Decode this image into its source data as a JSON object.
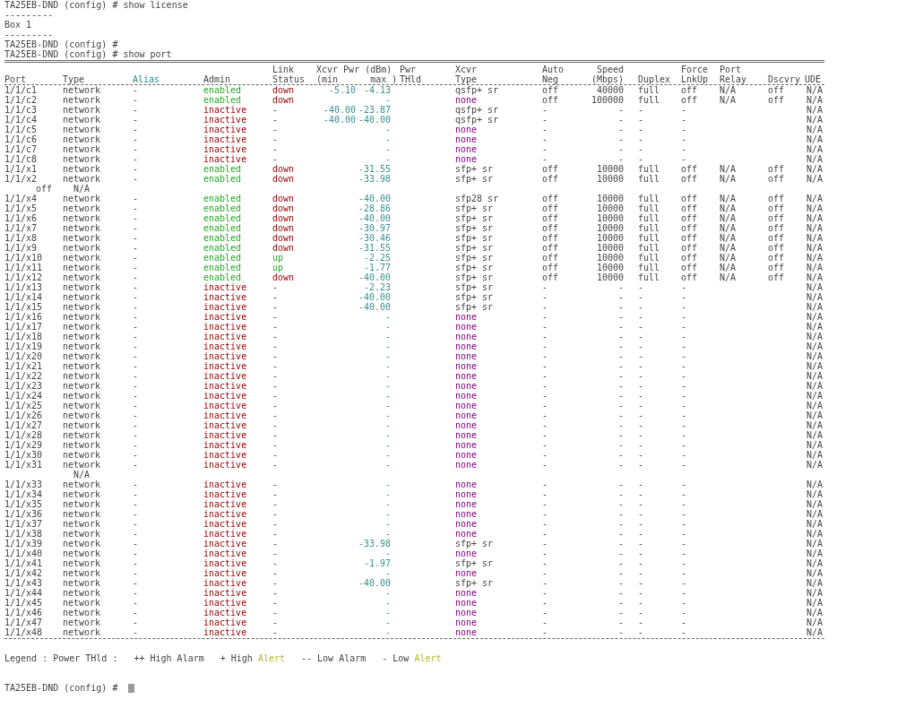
{
  "lines_before": [
    "TA25EB-DND (config) # show license",
    "---------",
    "Box 1",
    "---------",
    "TA25EB-DND (config) #",
    "TA25EB-DND (config) # show port"
  ],
  "table": {
    "columns": [
      {
        "kind": "port",
        "label": "Port"
      },
      {
        "kind": "type",
        "label": "Type"
      },
      {
        "kind": "alias",
        "label": "Alias"
      },
      {
        "kind": "admin",
        "label": "Admin"
      },
      {
        "kind": "link",
        "label": "Link\nStatus"
      },
      {
        "kind": "pwr",
        "label": "Xcvr Pwr (dBm)\n(min      max )"
      },
      {
        "kind": "thld",
        "label": "Pwr\nTHld"
      },
      {
        "kind": "xcvr",
        "label": "Xcvr\nType"
      },
      {
        "kind": "auto",
        "label": "Auto\nNeg"
      },
      {
        "kind": "speed",
        "label": "Speed\n(Mbps)"
      },
      {
        "kind": "duplex",
        "label": "Duplex"
      },
      {
        "kind": "force",
        "label": "Force\nLnkUp"
      },
      {
        "kind": "relay",
        "label": "Port\nRelay"
      },
      {
        "kind": "dscvry",
        "label": "Dscvry"
      },
      {
        "kind": "ude",
        "label": "UDE"
      }
    ],
    "rows": [
      {
        "kind": "port",
        "port": "1/1/c1",
        "type": "network",
        "alias": "-",
        "admin": "enabled",
        "enabled": true,
        "link": "down",
        "link_up": false,
        "pwr_min": "-5.10",
        "pwr_max": "-4.13",
        "xcvr": "qsfp+ sr",
        "xcvr_present": true,
        "auto_neg": "off",
        "speed": "40000",
        "duplex": "full",
        "force_lnkup": "off",
        "port_relay": "N/A",
        "dscvry": "off",
        "ude": "N/A"
      },
      {
        "kind": "port",
        "port": "1/1/c2",
        "type": "network",
        "alias": "-",
        "admin": "enabled",
        "enabled": true,
        "link": "down",
        "link_up": false,
        "pwr_max": "-",
        "xcvr": "none",
        "xcvr_present": false,
        "auto_neg": "off",
        "speed": "100000",
        "duplex": "full",
        "force_lnkup": "off",
        "port_relay": "N/A",
        "dscvry": "off",
        "ude": "N/A"
      },
      {
        "kind": "port",
        "port": "1/1/c3",
        "type": "network",
        "alias": "-",
        "admin": "inactive",
        "enabled": false,
        "link": "-",
        "pwr_min": "-40.00",
        "pwr_max": "-23.87",
        "xcvr": "qsfp+ sr",
        "xcvr_present": true,
        "auto_neg": "-",
        "speed": "-",
        "duplex": "-",
        "force_lnkup": "-",
        "ude": "N/A"
      },
      {
        "kind": "port",
        "port": "1/1/c4",
        "type": "network",
        "alias": "-",
        "admin": "inactive",
        "enabled": false,
        "link": "-",
        "pwr_min": "-40.00",
        "pwr_max": "-40.00",
        "xcvr": "qsfp+ sr",
        "xcvr_present": true,
        "auto_neg": "-",
        "speed": "-",
        "duplex": "-",
        "force_lnkup": "-",
        "ude": "N/A"
      },
      {
        "kind": "port",
        "port": "1/1/c5",
        "type": "network",
        "alias": "-",
        "admin": "inactive",
        "enabled": false,
        "link": "-",
        "pwr_max": "-",
        "xcvr": "none",
        "xcvr_present": false,
        "auto_neg": "-",
        "speed": "-",
        "duplex": "-",
        "force_lnkup": "-",
        "ude": "N/A"
      },
      {
        "kind": "port",
        "port": "1/1/c6",
        "type": "network",
        "alias": "-",
        "admin": "inactive",
        "enabled": false,
        "link": "-",
        "pwr_max": "-",
        "xcvr": "none",
        "xcvr_present": false,
        "auto_neg": "-",
        "speed": "-",
        "duplex": "-",
        "force_lnkup": "-",
        "ude": "N/A"
      },
      {
        "kind": "port",
        "port": "1/1/c7",
        "type": "network",
        "alias": "-",
        "admin": "inactive",
        "enabled": false,
        "link": "-",
        "pwr_max": "-",
        "xcvr": "none",
        "xcvr_present": false,
        "auto_neg": "-",
        "speed": "-",
        "duplex": "-",
        "force_lnkup": "-",
        "ude": "N/A"
      },
      {
        "kind": "port",
        "port": "1/1/c8",
        "type": "network",
        "alias": "-",
        "admin": "inactive",
        "enabled": false,
        "link": "-",
        "pwr_max": "-",
        "xcvr": "none",
        "xcvr_present": false,
        "auto_neg": "-",
        "speed": "-",
        "duplex": "-",
        "force_lnkup": "-",
        "ude": "N/A"
      },
      {
        "kind": "port",
        "port": "1/1/x1",
        "type": "network",
        "alias": "-",
        "admin": "enabled",
        "enabled": true,
        "link": "down",
        "link_up": false,
        "pwr_max": "-31.55",
        "xcvr": "sfp+ sr",
        "xcvr_present": true,
        "auto_neg": "off",
        "speed": "10000",
        "duplex": "full",
        "force_lnkup": "off",
        "port_relay": "N/A",
        "dscvry": "off",
        "ude": "N/A"
      },
      {
        "kind": "port",
        "port": "1/1/x2",
        "type": "network",
        "alias": "-",
        "admin": "enabled",
        "enabled": true,
        "link": "down",
        "link_up": false,
        "pwr_max": "-33.98",
        "xcvr": "sfp+ sr",
        "xcvr_present": true,
        "auto_neg": "off",
        "speed": "10000",
        "duplex": "full",
        "force_lnkup": "off",
        "port_relay": "N/A",
        "dscvry": "off",
        "ude": "N/A"
      },
      {
        "kind": "wrap",
        "parts": [
          "off",
          "N/A"
        ]
      },
      {
        "kind": "port",
        "port": "1/1/x4",
        "type": "network",
        "alias": "-",
        "admin": "enabled",
        "enabled": true,
        "link": "down",
        "link_up": false,
        "pwr_max": "-40.00",
        "xcvr": "sfp28 sr",
        "xcvr_present": true,
        "auto_neg": "off",
        "speed": "10000",
        "duplex": "full",
        "force_lnkup": "off",
        "port_relay": "N/A",
        "dscvry": "off",
        "ude": "N/A"
      },
      {
        "kind": "port",
        "port": "1/1/x5",
        "type": "network",
        "alias": "-",
        "admin": "enabled",
        "enabled": true,
        "link": "down",
        "link_up": false,
        "pwr_max": "-28.86",
        "xcvr": "sfp+ sr",
        "xcvr_present": true,
        "auto_neg": "off",
        "speed": "10000",
        "duplex": "full",
        "force_lnkup": "off",
        "port_relay": "N/A",
        "dscvry": "off",
        "ude": "N/A"
      },
      {
        "kind": "port",
        "port": "1/1/x6",
        "type": "network",
        "alias": "-",
        "admin": "enabled",
        "enabled": true,
        "link": "down",
        "link_up": false,
        "pwr_max": "-40.00",
        "xcvr": "sfp+ sr",
        "xcvr_present": true,
        "auto_neg": "off",
        "speed": "10000",
        "duplex": "full",
        "force_lnkup": "off",
        "port_relay": "N/A",
        "dscvry": "off",
        "ude": "N/A"
      },
      {
        "kind": "port",
        "port": "1/1/x7",
        "type": "network",
        "alias": "-",
        "admin": "enabled",
        "enabled": true,
        "link": "down",
        "link_up": false,
        "pwr_max": "-30.97",
        "xcvr": "sfp+ sr",
        "xcvr_present": true,
        "auto_neg": "off",
        "speed": "10000",
        "duplex": "full",
        "force_lnkup": "off",
        "port_relay": "N/A",
        "dscvry": "off",
        "ude": "N/A"
      },
      {
        "kind": "port",
        "port": "1/1/x8",
        "type": "network",
        "alias": "-",
        "admin": "enabled",
        "enabled": true,
        "link": "down",
        "link_up": false,
        "pwr_max": "-30.46",
        "xcvr": "sfp+ sr",
        "xcvr_present": true,
        "auto_neg": "off",
        "speed": "10000",
        "duplex": "full",
        "force_lnkup": "off",
        "port_relay": "N/A",
        "dscvry": "off",
        "ude": "N/A"
      },
      {
        "kind": "port",
        "port": "1/1/x9",
        "type": "network",
        "alias": "-",
        "admin": "enabled",
        "enabled": true,
        "link": "down",
        "link_up": false,
        "pwr_max": "-31.55",
        "xcvr": "sfp+ sr",
        "xcvr_present": true,
        "auto_neg": "off",
        "speed": "10000",
        "duplex": "full",
        "force_lnkup": "off",
        "port_relay": "N/A",
        "dscvry": "off",
        "ude": "N/A"
      },
      {
        "kind": "port",
        "port": "1/1/x10",
        "type": "network",
        "alias": "-",
        "admin": "enabled",
        "enabled": true,
        "link": "up",
        "link_up": true,
        "pwr_max": "-2.25",
        "xcvr": "sfp+ sr",
        "xcvr_present": true,
        "auto_neg": "off",
        "speed": "10000",
        "duplex": "full",
        "force_lnkup": "off",
        "port_relay": "N/A",
        "dscvry": "off",
        "ude": "N/A"
      },
      {
        "kind": "port",
        "port": "1/1/x11",
        "type": "network",
        "alias": "-",
        "admin": "enabled",
        "enabled": true,
        "link": "up",
        "link_up": true,
        "pwr_max": "-1.77",
        "xcvr": "sfp+ sr",
        "xcvr_present": true,
        "auto_neg": "off",
        "speed": "10000",
        "duplex": "full",
        "force_lnkup": "off",
        "port_relay": "N/A",
        "dscvry": "off",
        "ude": "N/A"
      },
      {
        "kind": "port",
        "port": "1/1/x12",
        "type": "network",
        "alias": "-",
        "admin": "enabled",
        "enabled": true,
        "link": "down",
        "link_up": false,
        "pwr_max": "-40.00",
        "xcvr": "sfp+ sr",
        "xcvr_present": true,
        "auto_neg": "off",
        "speed": "10000",
        "duplex": "full",
        "force_lnkup": "off",
        "port_relay": "N/A",
        "dscvry": "off",
        "ude": "N/A"
      },
      {
        "kind": "port",
        "port": "1/1/x13",
        "type": "network",
        "alias": "-",
        "admin": "inactive",
        "enabled": false,
        "link": "-",
        "pwr_max": "-2.23",
        "xcvr": "sfp+ sr",
        "xcvr_present": true,
        "auto_neg": "-",
        "speed": "-",
        "duplex": "-",
        "force_lnkup": "-",
        "ude": "N/A"
      },
      {
        "kind": "port",
        "port": "1/1/x14",
        "type": "network",
        "alias": "-",
        "admin": "inactive",
        "enabled": false,
        "link": "-",
        "pwr_max": "-40.00",
        "xcvr": "sfp+ sr",
        "xcvr_present": true,
        "auto_neg": "-",
        "speed": "-",
        "duplex": "-",
        "force_lnkup": "-",
        "ude": "N/A"
      },
      {
        "kind": "port",
        "port": "1/1/x15",
        "type": "network",
        "alias": "-",
        "admin": "inactive",
        "enabled": false,
        "link": "-",
        "pwr_max": "-40.00",
        "xcvr": "sfp+ sr",
        "xcvr_present": true,
        "auto_neg": "-",
        "speed": "-",
        "duplex": "-",
        "force_lnkup": "-",
        "ude": "N/A"
      },
      {
        "kind": "port",
        "port": "1/1/x16",
        "type": "network",
        "alias": "-",
        "admin": "inactive",
        "enabled": false,
        "link": "-",
        "pwr_max": "-",
        "xcvr": "none",
        "xcvr_present": false,
        "auto_neg": "-",
        "speed": "-",
        "duplex": "-",
        "force_lnkup": "-",
        "ude": "N/A"
      },
      {
        "kind": "port",
        "port": "1/1/x17",
        "type": "network",
        "alias": "-",
        "admin": "inactive",
        "enabled": false,
        "link": "-",
        "pwr_max": "-",
        "xcvr": "none",
        "xcvr_present": false,
        "auto_neg": "-",
        "speed": "-",
        "duplex": "-",
        "force_lnkup": "-",
        "ude": "N/A"
      },
      {
        "kind": "port",
        "port": "1/1/x18",
        "type": "network",
        "alias": "-",
        "admin": "inactive",
        "enabled": false,
        "link": "-",
        "pwr_max": "-",
        "xcvr": "none",
        "xcvr_present": false,
        "auto_neg": "-",
        "speed": "-",
        "duplex": "-",
        "force_lnkup": "-",
        "ude": "N/A"
      },
      {
        "kind": "port",
        "port": "1/1/x19",
        "type": "network",
        "alias": "-",
        "admin": "inactive",
        "enabled": false,
        "link": "-",
        "pwr_max": "-",
        "xcvr": "none",
        "xcvr_present": false,
        "auto_neg": "-",
        "speed": "-",
        "duplex": "-",
        "force_lnkup": "-",
        "ude": "N/A"
      },
      {
        "kind": "port",
        "port": "1/1/x20",
        "type": "network",
        "alias": "-",
        "admin": "inactive",
        "enabled": false,
        "link": "-",
        "pwr_max": "-",
        "xcvr": "none",
        "xcvr_present": false,
        "auto_neg": "-",
        "speed": "-",
        "duplex": "-",
        "force_lnkup": "-",
        "ude": "N/A"
      },
      {
        "kind": "port",
        "port": "1/1/x21",
        "type": "network",
        "alias": "-",
        "admin": "inactive",
        "enabled": false,
        "link": "-",
        "pwr_max": "-",
        "xcvr": "none",
        "xcvr_present": false,
        "auto_neg": "-",
        "speed": "-",
        "duplex": "-",
        "force_lnkup": "-",
        "ude": "N/A"
      },
      {
        "kind": "port",
        "port": "1/1/x22",
        "type": "network",
        "alias": "-",
        "admin": "inactive",
        "enabled": false,
        "link": "-",
        "pwr_max": "-",
        "xcvr": "none",
        "xcvr_present": false,
        "auto_neg": "-",
        "speed": "-",
        "duplex": "-",
        "force_lnkup": "-",
        "ude": "N/A"
      },
      {
        "kind": "port",
        "port": "1/1/x23",
        "type": "network",
        "alias": "-",
        "admin": "inactive",
        "enabled": false,
        "link": "-",
        "pwr_max": "-",
        "xcvr": "none",
        "xcvr_present": false,
        "auto_neg": "-",
        "speed": "-",
        "duplex": "-",
        "force_lnkup": "-",
        "ude": "N/A"
      },
      {
        "kind": "port",
        "port": "1/1/x24",
        "type": "network",
        "alias": "-",
        "admin": "inactive",
        "enabled": false,
        "link": "-",
        "pwr_max": "-",
        "xcvr": "none",
        "xcvr_present": false,
        "auto_neg": "-",
        "speed": "-",
        "duplex": "-",
        "force_lnkup": "-",
        "ude": "N/A"
      },
      {
        "kind": "port",
        "port": "1/1/x25",
        "type": "network",
        "alias": "-",
        "admin": "inactive",
        "enabled": false,
        "link": "-",
        "pwr_max": "-",
        "xcvr": "none",
        "xcvr_present": false,
        "auto_neg": "-",
        "speed": "-",
        "duplex": "-",
        "force_lnkup": "-",
        "ude": "N/A"
      },
      {
        "kind": "port",
        "port": "1/1/x26",
        "type": "network",
        "alias": "-",
        "admin": "inactive",
        "enabled": false,
        "link": "-",
        "pwr_max": "-",
        "xcvr": "none",
        "xcvr_present": false,
        "auto_neg": "-",
        "speed": "-",
        "duplex": "-",
        "force_lnkup": "-",
        "ude": "N/A"
      },
      {
        "kind": "port",
        "port": "1/1/x27",
        "type": "network",
        "alias": "-",
        "admin": "inactive",
        "enabled": false,
        "link": "-",
        "pwr_max": "-",
        "xcvr": "none",
        "xcvr_present": false,
        "auto_neg": "-",
        "speed": "-",
        "duplex": "-",
        "force_lnkup": "-",
        "ude": "N/A"
      },
      {
        "kind": "port",
        "port": "1/1/x28",
        "type": "network",
        "alias": "-",
        "admin": "inactive",
        "enabled": false,
        "link": "-",
        "pwr_max": "-",
        "xcvr": "none",
        "xcvr_present": false,
        "auto_neg": "-",
        "speed": "-",
        "duplex": "-",
        "force_lnkup": "-",
        "ude": "N/A"
      },
      {
        "kind": "port",
        "port": "1/1/x29",
        "type": "network",
        "alias": "-",
        "admin": "inactive",
        "enabled": false,
        "link": "-",
        "pwr_max": "-",
        "xcvr": "none",
        "xcvr_present": false,
        "auto_neg": "-",
        "speed": "-",
        "duplex": "-",
        "force_lnkup": "-",
        "ude": "N/A"
      },
      {
        "kind": "port",
        "port": "1/1/x30",
        "type": "network",
        "alias": "-",
        "admin": "inactive",
        "enabled": false,
        "link": "-",
        "pwr_max": "-",
        "xcvr": "none",
        "xcvr_present": false,
        "auto_neg": "-",
        "speed": "-",
        "duplex": "-",
        "force_lnkup": "-",
        "ude": "N/A"
      },
      {
        "kind": "port",
        "port": "1/1/x31",
        "type": "network",
        "alias": "-",
        "admin": "inactive",
        "enabled": false,
        "link": "-",
        "pwr_max": "-",
        "xcvr": "none",
        "xcvr_present": false,
        "auto_neg": "-",
        "speed": "-",
        "duplex": "-",
        "force_lnkup": "-",
        "ude": "N/A"
      },
      {
        "kind": "wrap",
        "parts": [
          "N/A"
        ]
      },
      {
        "kind": "port",
        "port": "1/1/x33",
        "type": "network",
        "alias": "-",
        "admin": "inactive",
        "enabled": false,
        "link": "-",
        "pwr_max": "-",
        "xcvr": "none",
        "xcvr_present": false,
        "auto_neg": "-",
        "speed": "-",
        "duplex": "-",
        "force_lnkup": "-",
        "ude": "N/A"
      },
      {
        "kind": "port",
        "port": "1/1/x34",
        "type": "network",
        "alias": "-",
        "admin": "inactive",
        "enabled": false,
        "link": "-",
        "pwr_max": "-",
        "xcvr": "none",
        "xcvr_present": false,
        "auto_neg": "-",
        "speed": "-",
        "duplex": "-",
        "force_lnkup": "-",
        "ude": "N/A"
      },
      {
        "kind": "port",
        "port": "1/1/x35",
        "type": "network",
        "alias": "-",
        "admin": "inactive",
        "enabled": false,
        "link": "-",
        "pwr_max": "-",
        "xcvr": "none",
        "xcvr_present": false,
        "auto_neg": "-",
        "speed": "-",
        "duplex": "-",
        "force_lnkup": "-",
        "ude": "N/A"
      },
      {
        "kind": "port",
        "port": "1/1/x36",
        "type": "network",
        "alias": "-",
        "admin": "inactive",
        "enabled": false,
        "link": "-",
        "pwr_max": "-",
        "xcvr": "none",
        "xcvr_present": false,
        "auto_neg": "-",
        "speed": "-",
        "duplex": "-",
        "force_lnkup": "-",
        "ude": "N/A"
      },
      {
        "kind": "port",
        "port": "1/1/x37",
        "type": "network",
        "alias": "-",
        "admin": "inactive",
        "enabled": false,
        "link": "-",
        "pwr_max": "-",
        "xcvr": "none",
        "xcvr_present": false,
        "auto_neg": "-",
        "speed": "-",
        "duplex": "-",
        "force_lnkup": "-",
        "ude": "N/A"
      },
      {
        "kind": "port",
        "port": "1/1/x38",
        "type": "network",
        "alias": "-",
        "admin": "inactive",
        "enabled": false,
        "link": "-",
        "pwr_max": "-",
        "xcvr": "none",
        "xcvr_present": false,
        "auto_neg": "-",
        "speed": "-",
        "duplex": "-",
        "force_lnkup": "-",
        "ude": "N/A"
      },
      {
        "kind": "port",
        "port": "1/1/x39",
        "type": "network",
        "alias": "-",
        "admin": "inactive",
        "enabled": false,
        "link": "-",
        "pwr_max": "-33.98",
        "xcvr": "sfp+ sr",
        "xcvr_present": true,
        "auto_neg": "-",
        "speed": "-",
        "duplex": "-",
        "force_lnkup": "-",
        "ude": "N/A"
      },
      {
        "kind": "port",
        "port": "1/1/x40",
        "type": "network",
        "alias": "-",
        "admin": "inactive",
        "enabled": false,
        "link": "-",
        "pwr_max": "-",
        "xcvr": "none",
        "xcvr_present": false,
        "auto_neg": "-",
        "speed": "-",
        "duplex": "-",
        "force_lnkup": "-",
        "ude": "N/A"
      },
      {
        "kind": "port",
        "port": "1/1/x41",
        "type": "network",
        "alias": "-",
        "admin": "inactive",
        "enabled": false,
        "link": "-",
        "pwr_max": "-1.97",
        "xcvr": "sfp+ sr",
        "xcvr_present": true,
        "auto_neg": "-",
        "speed": "-",
        "duplex": "-",
        "force_lnkup": "-",
        "ude": "N/A"
      },
      {
        "kind": "port",
        "port": "1/1/x42",
        "type": "network",
        "alias": "-",
        "admin": "inactive",
        "enabled": false,
        "link": "-",
        "pwr_max": "-",
        "xcvr": "none",
        "xcvr_present": false,
        "auto_neg": "-",
        "speed": "-",
        "duplex": "-",
        "force_lnkup": "-",
        "ude": "N/A"
      },
      {
        "kind": "port",
        "port": "1/1/x43",
        "type": "network",
        "alias": "-",
        "admin": "inactive",
        "enabled": false,
        "link": "-",
        "pwr_max": "-40.00",
        "xcvr": "sfp+ sr",
        "xcvr_present": true,
        "auto_neg": "-",
        "speed": "-",
        "duplex": "-",
        "force_lnkup": "-",
        "ude": "N/A"
      },
      {
        "kind": "port",
        "port": "1/1/x44",
        "type": "network",
        "alias": "-",
        "admin": "inactive",
        "enabled": false,
        "link": "-",
        "pwr_max": "-",
        "xcvr": "none",
        "xcvr_present": false,
        "auto_neg": "-",
        "speed": "-",
        "duplex": "-",
        "force_lnkup": "-",
        "ude": "N/A"
      },
      {
        "kind": "port",
        "port": "1/1/x45",
        "type": "network",
        "alias": "-",
        "admin": "inactive",
        "enabled": false,
        "link": "-",
        "pwr_max": "-",
        "xcvr": "none",
        "xcvr_present": false,
        "auto_neg": "-",
        "speed": "-",
        "duplex": "-",
        "force_lnkup": "-",
        "ude": "N/A"
      },
      {
        "kind": "port",
        "port": "1/1/x46",
        "type": "network",
        "alias": "-",
        "admin": "inactive",
        "enabled": false,
        "link": "-",
        "pwr_max": "-",
        "xcvr": "none",
        "xcvr_present": false,
        "auto_neg": "-",
        "speed": "-",
        "duplex": "-",
        "force_lnkup": "-",
        "ude": "N/A"
      },
      {
        "kind": "port",
        "port": "1/1/x47",
        "type": "network",
        "alias": "-",
        "admin": "inactive",
        "enabled": false,
        "link": "-",
        "pwr_max": "-",
        "xcvr": "none",
        "xcvr_present": false,
        "auto_neg": "-",
        "speed": "-",
        "duplex": "-",
        "force_lnkup": "-",
        "ude": "N/A"
      },
      {
        "kind": "port",
        "port": "1/1/x48",
        "type": "network",
        "alias": "-",
        "admin": "inactive",
        "enabled": false,
        "link": "-",
        "pwr_max": "-",
        "xcvr": "none",
        "xcvr_present": false,
        "auto_neg": "-",
        "speed": "-",
        "duplex": "-",
        "force_lnkup": "-",
        "ude": "N/A"
      }
    ]
  },
  "legend": {
    "label": "Legend : Power THld :",
    "entries": [
      {
        "sign": "++ High",
        "word": "Alarm",
        "alert": false
      },
      {
        "sign": "+ High",
        "word": "Alert",
        "alert": true
      },
      {
        "sign": "-- Low",
        "word": "Alarm",
        "alert": false
      },
      {
        "sign": "- Low",
        "word": "Alert",
        "alert": true
      }
    ]
  },
  "prompt": "TA25EB-DND (config) #"
}
